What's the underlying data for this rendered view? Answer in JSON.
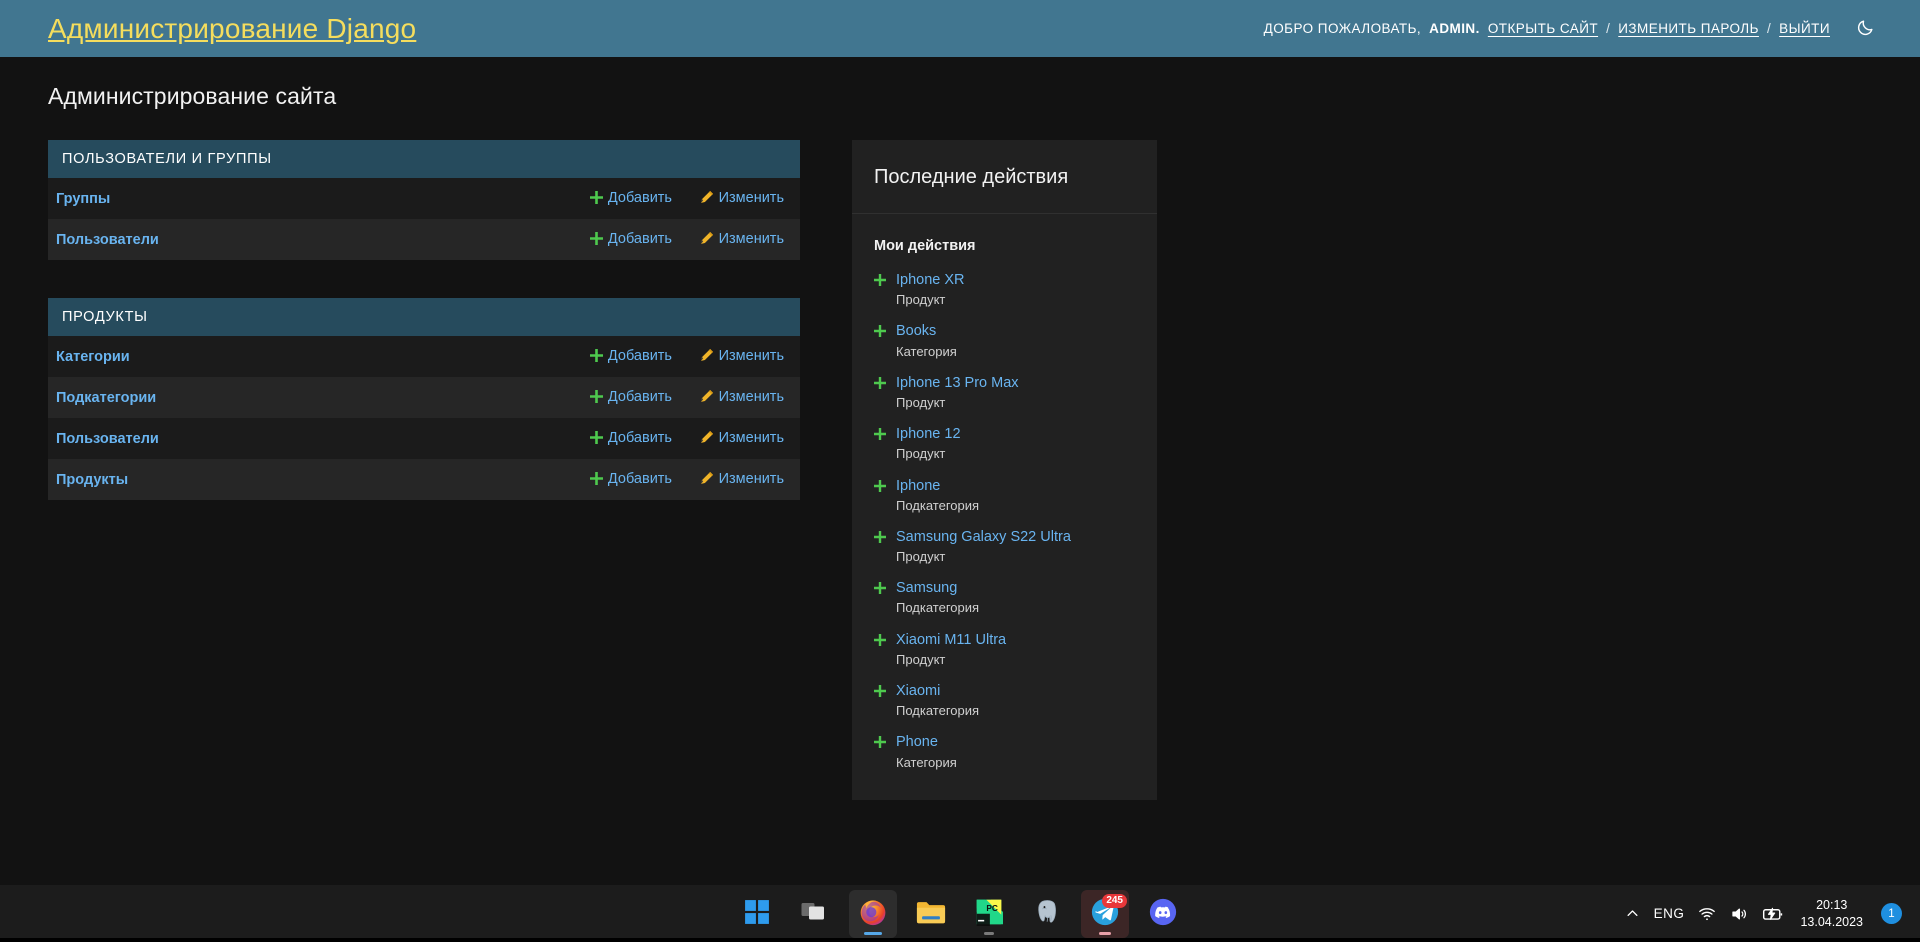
{
  "header": {
    "branding": "Администрирование Django",
    "welcome_prefix": "Добро пожаловать,",
    "welcome_user": "ADMIN.",
    "links": [
      {
        "label": "Открыть сайт"
      },
      {
        "label": "Изменить пароль"
      },
      {
        "label": "Выйти"
      }
    ],
    "separator": "/",
    "theme_toggle_icon": "moon-icon",
    "bg_color": "#417690",
    "title_color": "#f5dd5d"
  },
  "page": {
    "title": "Администрирование сайта"
  },
  "apps": [
    {
      "name": "Пользователи и группы",
      "models": [
        {
          "name": "Группы",
          "add_label": "Добавить",
          "change_label": "Изменить"
        },
        {
          "name": "Пользователи",
          "add_label": "Добавить",
          "change_label": "Изменить"
        }
      ]
    },
    {
      "name": "Продукты",
      "models": [
        {
          "name": "Категории",
          "add_label": "Добавить",
          "change_label": "Изменить"
        },
        {
          "name": "Подкатегории",
          "add_label": "Добавить",
          "change_label": "Изменить"
        },
        {
          "name": "Пользователи",
          "add_label": "Добавить",
          "change_label": "Изменить"
        },
        {
          "name": "Продукты",
          "add_label": "Добавить",
          "change_label": "Изменить"
        }
      ]
    }
  ],
  "recent_actions": {
    "title": "Последние действия",
    "subtitle": "Мои действия",
    "entries": [
      {
        "object": "Iphone XR",
        "model": "Продукт",
        "action": "addition"
      },
      {
        "object": "Books",
        "model": "Категория",
        "action": "addition"
      },
      {
        "object": "Iphone 13 Pro Max",
        "model": "Продукт",
        "action": "addition"
      },
      {
        "object": "Iphone 12",
        "model": "Продукт",
        "action": "addition"
      },
      {
        "object": "Iphone",
        "model": "Подкатегория",
        "action": "addition"
      },
      {
        "object": "Samsung Galaxy S22 Ultra",
        "model": "Продукт",
        "action": "addition"
      },
      {
        "object": "Samsung",
        "model": "Подкатегория",
        "action": "addition"
      },
      {
        "object": "Xiaomi M11 Ultra",
        "model": "Продукт",
        "action": "addition"
      },
      {
        "object": "Xiaomi",
        "model": "Подкатегория",
        "action": "addition"
      },
      {
        "object": "Phone",
        "model": "Категория",
        "action": "addition"
      }
    ]
  },
  "taskbar": {
    "buttons": [
      {
        "name": "start-button",
        "icon": "windows-start-icon"
      },
      {
        "name": "task-view-button",
        "icon": "task-view-icon"
      },
      {
        "name": "firefox-button",
        "icon": "firefox-icon",
        "active": true
      },
      {
        "name": "file-explorer-button",
        "icon": "folder-icon"
      },
      {
        "name": "pycharm-button",
        "icon": "pycharm-icon"
      },
      {
        "name": "postgresql-button",
        "icon": "postgresql-elephant-icon"
      },
      {
        "name": "telegram-button",
        "icon": "telegram-icon",
        "badge": "245"
      },
      {
        "name": "discord-button",
        "icon": "discord-icon"
      }
    ],
    "tray": {
      "overflow_icon": "chevron-up-icon",
      "language": "ENG",
      "wifi_icon": "wifi-icon",
      "volume_icon": "speaker-icon",
      "battery_icon": "battery-charging-icon",
      "time": "20:13",
      "date": "13.04.2023",
      "notification_count": "1"
    }
  }
}
